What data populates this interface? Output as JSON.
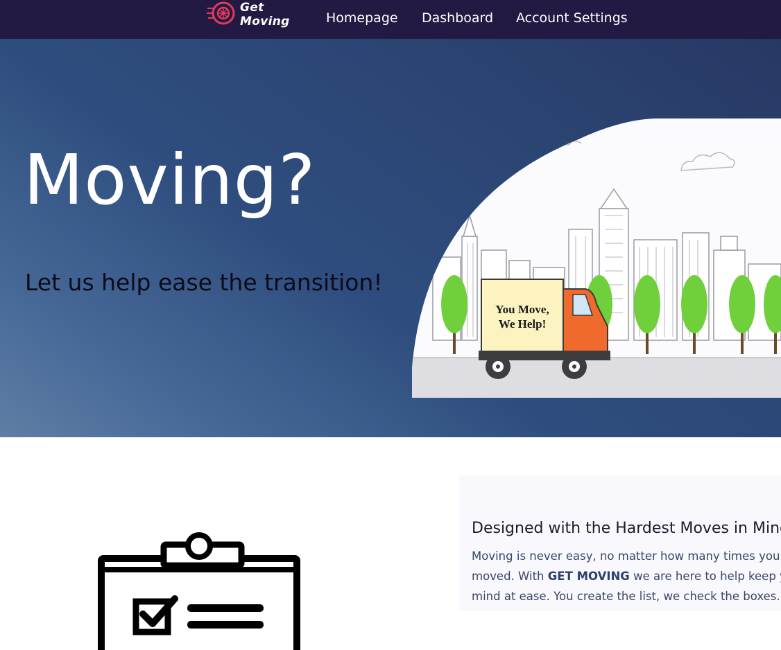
{
  "brand": {
    "name_line1": "Get",
    "name_line2": "Moving",
    "logo_icon": "wheel-icon",
    "logo_color": "#e23a5a"
  },
  "nav": {
    "links": [
      "Homepage",
      "Dashboard",
      "Account Settings"
    ]
  },
  "hero": {
    "title": "Moving?",
    "subtitle": "Let us help ease the transition!",
    "truck_sign_line1": "You Move,",
    "truck_sign_line2": "We Help!"
  },
  "feature": {
    "heading": "Designed with the Hardest Moves in Mind",
    "body_line1": "Moving is never easy, no matter how many times you've",
    "body_line2_before": "moved. With ",
    "body_line2_bold": "GET MOVING",
    "body_line2_after": " we are here to help keep your",
    "body_line3": "mind at ease. You create the list, we check the boxes.",
    "icon": "checklist-clipboard-icon"
  },
  "colors": {
    "navbar": "#231a44",
    "hero_gradient_light": "#5f7ea5",
    "hero_gradient_dark": "#283864",
    "truck_cab": "#ef6a2c",
    "tree_green": "#6fd03c"
  }
}
